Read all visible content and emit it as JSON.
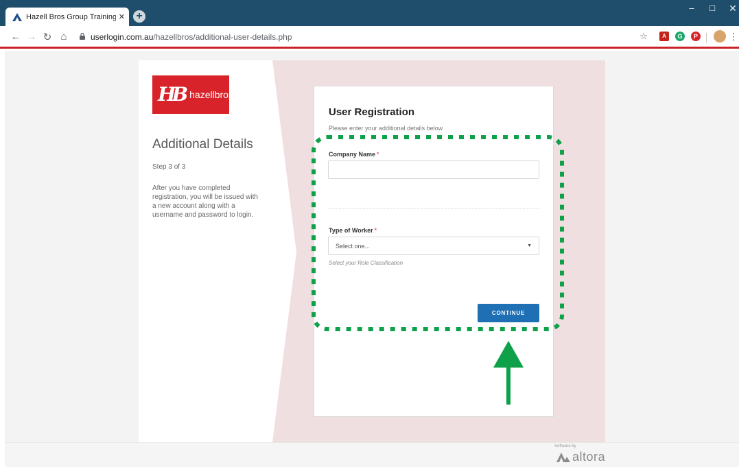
{
  "browser": {
    "tab_title": "Hazell Bros Group Training Platfo",
    "tab_close": "✕",
    "new_tab": "+",
    "url_host": "userlogin.com.au",
    "url_path": "/hazellbros/additional-user-details.php"
  },
  "brand": {
    "logo_mark": "HB",
    "logo_word": "hazellbros",
    "color": "#d8232a"
  },
  "sidebar": {
    "heading": "Additional Details",
    "step": "Step 3 of 3",
    "description": "After you have completed registration, you will be issued with a new account along with a username and password to login."
  },
  "form": {
    "title": "User Registration",
    "subtitle": "Please enter your additional details below",
    "company_label": "Company Name",
    "required_mark": "*",
    "company_value": "",
    "worker_label": "Type of Worker",
    "worker_selected": "Select one...",
    "worker_help": "Select your Role Classification",
    "continue_label": "CONTINUE",
    "button_color": "#1f6fb5"
  },
  "footer": {
    "powered_label": "Software by",
    "vendor": "altora"
  },
  "annotation": {
    "highlight_color": "#0ea14a"
  }
}
